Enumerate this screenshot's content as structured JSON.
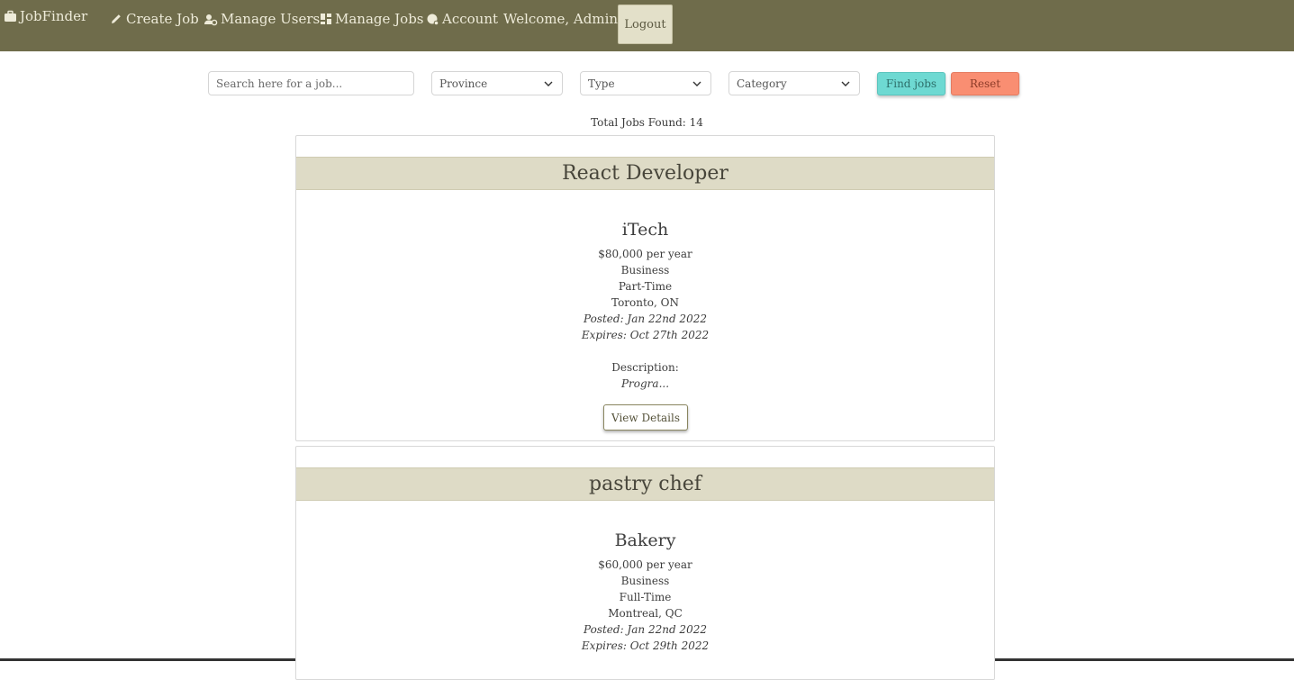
{
  "nav": {
    "brand": "JobFinder",
    "create_job": "Create Job",
    "manage_users": "Manage Users",
    "manage_jobs": "Manage Jobs",
    "account": "Account",
    "welcome": "Welcome, Admin",
    "logout": "Logout"
  },
  "filters": {
    "search_placeholder": "Search here for a job...",
    "province": "Province",
    "type": "Type",
    "category": "Category",
    "find_label": "Find jobs",
    "reset_label": "Reset"
  },
  "total_jobs": "Total Jobs Found: 14",
  "jobs": [
    {
      "title": "React Developer",
      "company": "iTech",
      "salary": "$80,000 per year",
      "category": "Business",
      "type": "Part-Time",
      "location": "Toronto, ON",
      "posted": "Posted: Jan 22nd 2022",
      "expires": "Expires: Oct 27th 2022",
      "description_label": "Description:",
      "description": "Progra...",
      "details_label": "View Details"
    },
    {
      "title": "pastry chef",
      "company": "Bakery",
      "salary": "$60,000 per year",
      "category": "Business",
      "type": "Full-Time",
      "location": "Montreal, QC",
      "posted": "Posted: Jan 22nd 2022",
      "expires": "Expires: Oct 29th 2022"
    }
  ],
  "colors": {
    "navbar": "#6f6c4b",
    "title_band": "#dedbc6",
    "find_button": "#6ed9d2",
    "reset_button": "#f98e72"
  }
}
